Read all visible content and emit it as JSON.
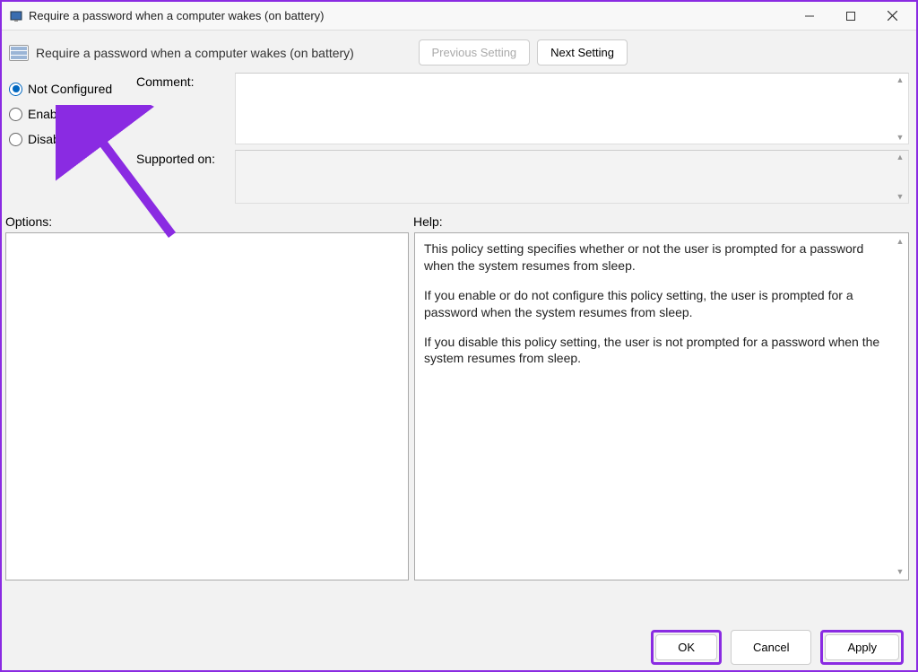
{
  "window": {
    "title": "Require a password when a computer wakes (on battery)"
  },
  "header": {
    "policy_title": "Require a password when a computer wakes (on battery)",
    "prev_label": "Previous Setting",
    "next_label": "Next Setting"
  },
  "radios": {
    "not_configured": "Not Configured",
    "enabled": "Enabled",
    "disabled": "Disabled",
    "selected": "not_configured"
  },
  "fields": {
    "comment_label": "Comment:",
    "comment_value": "",
    "supported_label": "Supported on:",
    "supported_value": ""
  },
  "labels": {
    "options": "Options:",
    "help": "Help:"
  },
  "help": {
    "p1": "This policy setting specifies whether or not the user is prompted for a password when the system resumes from sleep.",
    "p2": "If you enable or do not configure this policy setting, the user is prompted for a password when the system resumes from sleep.",
    "p3": "If you disable this policy setting, the user is not prompted for a password when the system resumes from sleep."
  },
  "footer": {
    "ok": "OK",
    "cancel": "Cancel",
    "apply": "Apply"
  },
  "annotation": {
    "arrow_color": "#8a2be2"
  }
}
